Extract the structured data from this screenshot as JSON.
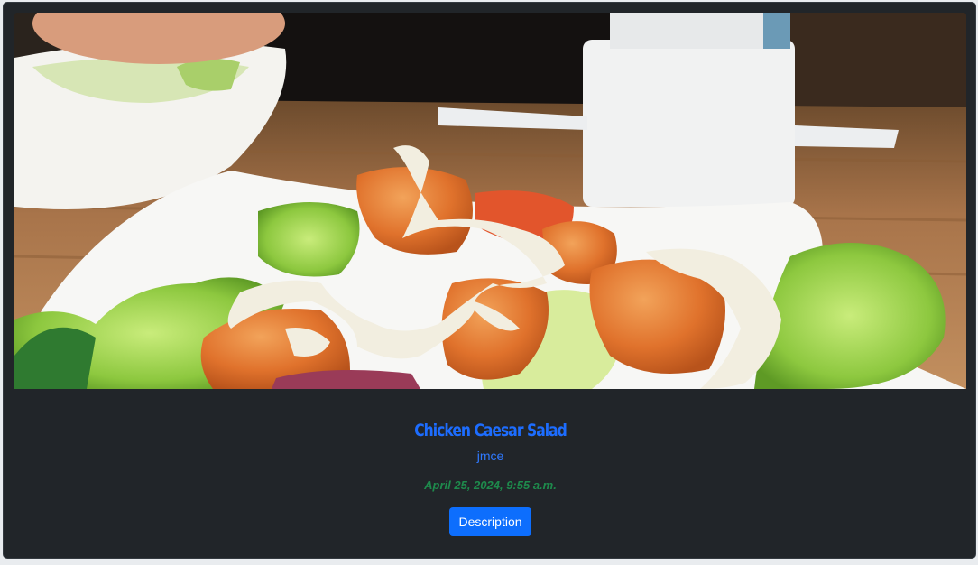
{
  "recipe_card": {
    "image_alt": "Chicken Caesar Salad photo",
    "title": "Chicken Caesar Salad",
    "author": "jmce",
    "date": "April 25, 2024, 9:55 a.m.",
    "button_label": "Description"
  },
  "colors": {
    "card_background": "#212529",
    "title": "#1d6dff",
    "author": "#2f79ff",
    "date": "#1e8a4c",
    "button": "#0d6efd"
  }
}
